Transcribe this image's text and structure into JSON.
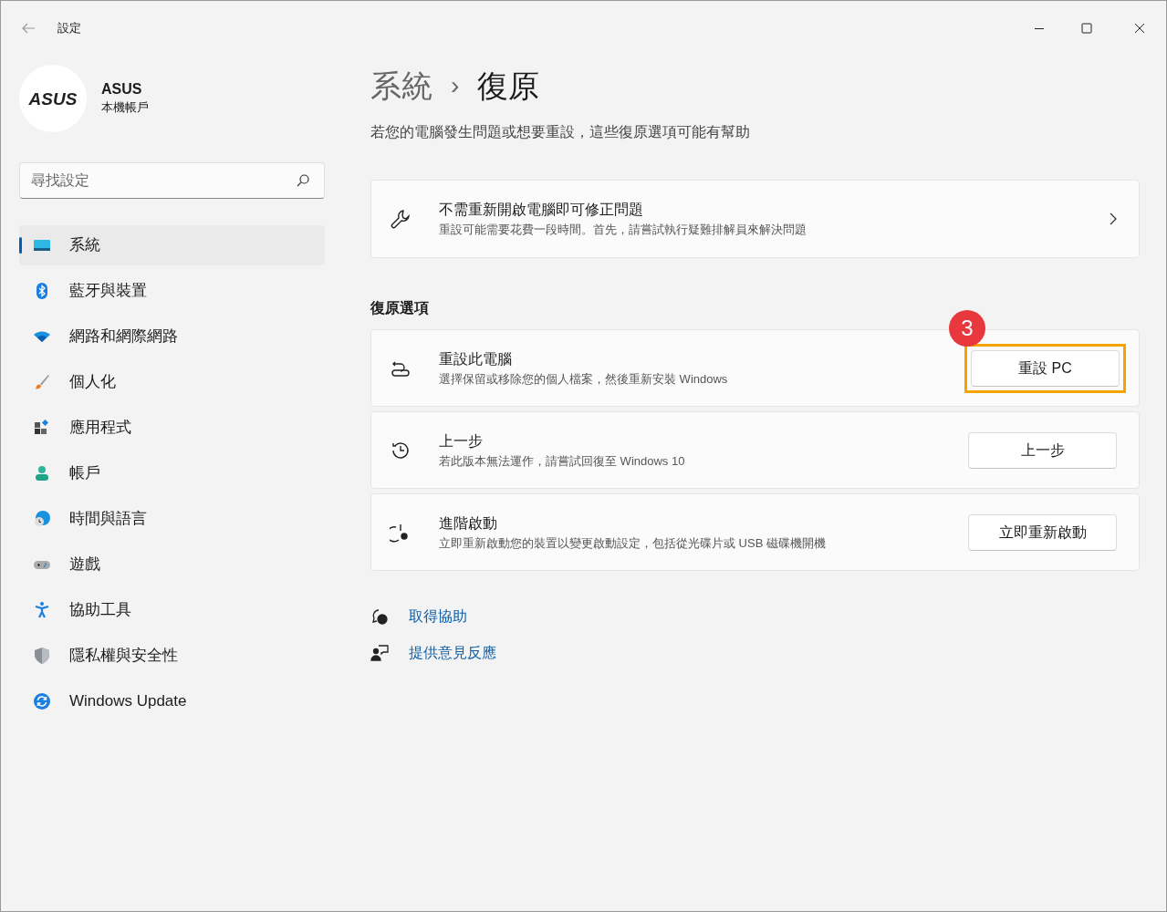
{
  "window": {
    "title": "設定"
  },
  "account": {
    "name": "ASUS",
    "type": "本機帳戶",
    "logo": "ASUS"
  },
  "search": {
    "placeholder": "尋找設定"
  },
  "sidebar": {
    "items": [
      {
        "label": "系統",
        "selected": true
      },
      {
        "label": "藍牙與裝置",
        "selected": false
      },
      {
        "label": "網路和網際網路",
        "selected": false
      },
      {
        "label": "個人化",
        "selected": false
      },
      {
        "label": "應用程式",
        "selected": false
      },
      {
        "label": "帳戶",
        "selected": false
      },
      {
        "label": "時間與語言",
        "selected": false
      },
      {
        "label": "遊戲",
        "selected": false
      },
      {
        "label": "協助工具",
        "selected": false
      },
      {
        "label": "隱私權與安全性",
        "selected": false
      },
      {
        "label": "Windows Update",
        "selected": false
      }
    ]
  },
  "breadcrumb": {
    "parent": "系統",
    "separator": "›",
    "current": "復原"
  },
  "description": "若您的電腦發生問題或想要重設，這些復原選項可能有幫助",
  "fix_card": {
    "title": "不需重新開啟電腦即可修正問題",
    "subtitle": "重設可能需要花費一段時間。首先，請嘗試執行疑難排解員來解決問題"
  },
  "section_title": "復原選項",
  "options": [
    {
      "title": "重設此電腦",
      "subtitle": "選擇保留或移除您的個人檔案，然後重新安裝 Windows",
      "button": "重設 PC",
      "highlighted": true,
      "callout": "3"
    },
    {
      "title": "上一步",
      "subtitle": "若此版本無法運作，請嘗試回復至 Windows 10",
      "button": "上一步",
      "highlighted": false
    },
    {
      "title": "進階啟動",
      "subtitle": "立即重新啟動您的裝置以變更啟動設定，包括從光碟片或 USB 磁碟機開機",
      "button": "立即重新啟動",
      "highlighted": false
    }
  ],
  "links": [
    "取得協助",
    "提供意見反應"
  ]
}
